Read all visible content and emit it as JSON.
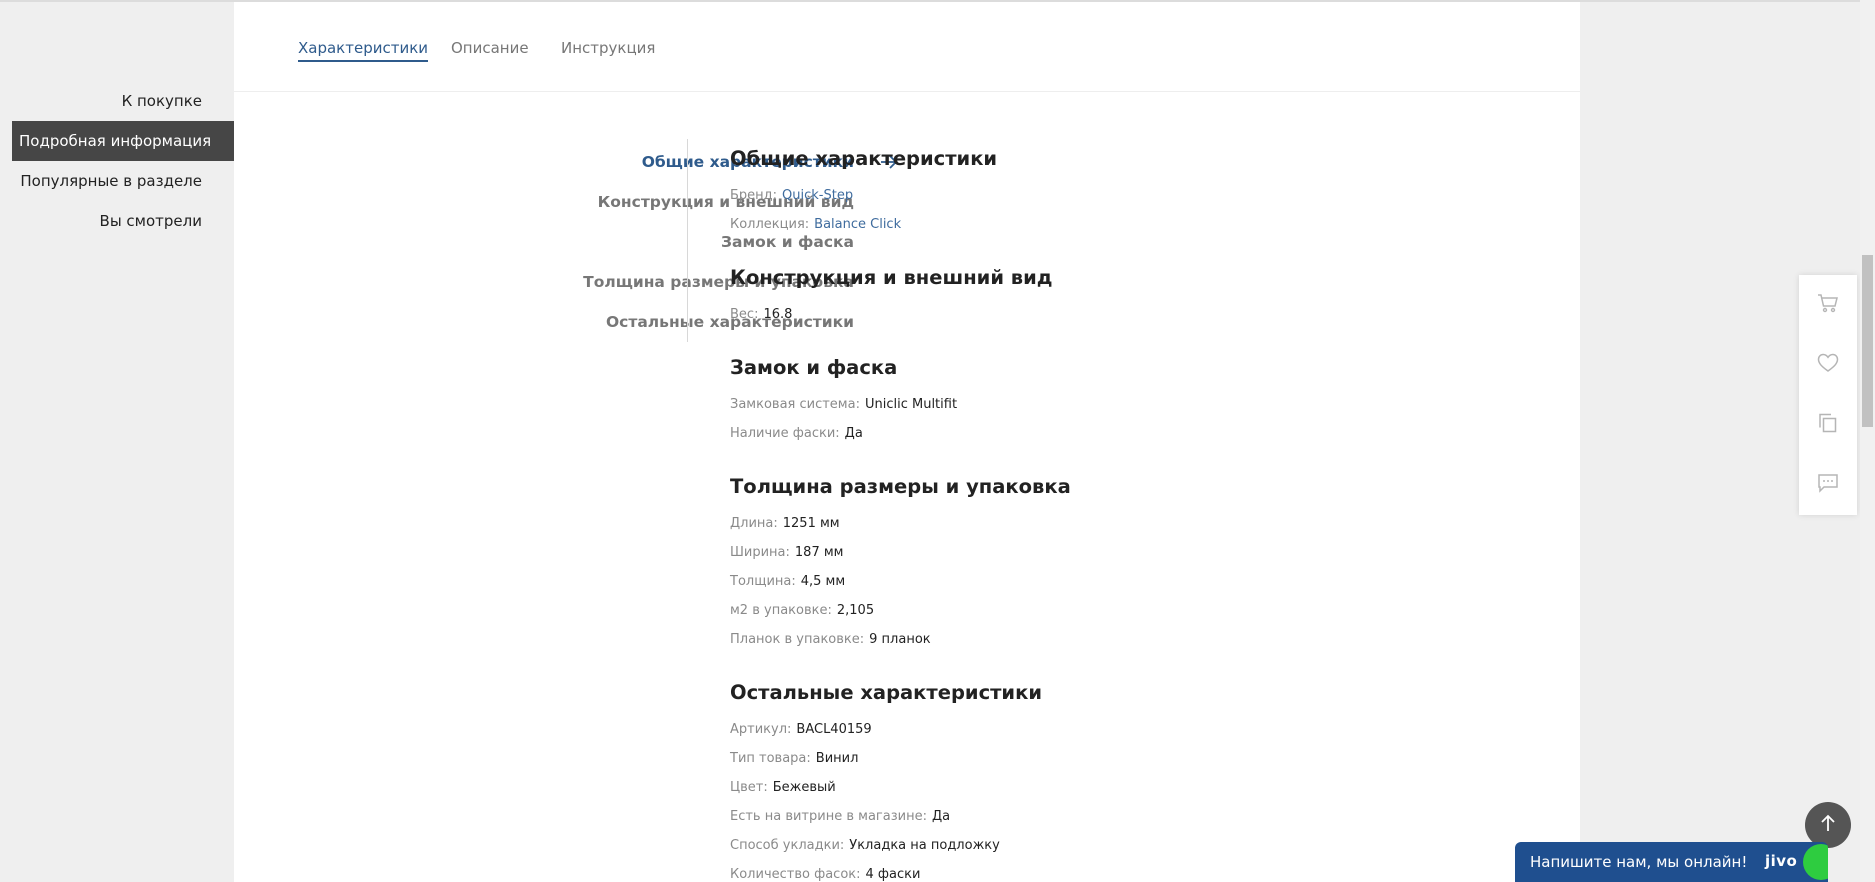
{
  "page_nav": {
    "items": [
      {
        "label": "К покупке",
        "active": false
      },
      {
        "label": "Подробная информация",
        "active": true
      },
      {
        "label": "Популярные в разделе",
        "active": false
      },
      {
        "label": "Вы смотрели",
        "active": false
      }
    ]
  },
  "tabs": [
    {
      "label": "Характеристики",
      "active": true
    },
    {
      "label": "Описание",
      "active": false
    },
    {
      "label": "Инструкция",
      "active": false
    }
  ],
  "section_nav": [
    {
      "label": "Общие характеристики",
      "active": true
    },
    {
      "label": "Конструкция и внешний вид",
      "active": false
    },
    {
      "label": "Замок и фаска",
      "active": false
    },
    {
      "label": "Толщина размеры и упаковка",
      "active": false
    },
    {
      "label": "Остальные характеристики",
      "active": false
    }
  ],
  "sections": [
    {
      "title": "Общие характеристики",
      "rows": [
        {
          "label": "Бренд:",
          "value": "Quick-Step",
          "link": true
        },
        {
          "label": "Коллекция:",
          "value": "Balance Click",
          "link": true
        }
      ]
    },
    {
      "title": "Конструкция и внешний вид",
      "rows": [
        {
          "label": "Вес:",
          "value": "16.8",
          "link": false
        }
      ]
    },
    {
      "title": "Замок и фаска",
      "rows": [
        {
          "label": "Замковая система:",
          "value": "Uniclic Multifit",
          "link": false
        },
        {
          "label": "Наличие фаски:",
          "value": "Да",
          "link": false
        }
      ]
    },
    {
      "title": "Толщина размеры и упаковка",
      "rows": [
        {
          "label": "Длина:",
          "value": "1251 мм",
          "link": false
        },
        {
          "label": "Ширина:",
          "value": "187 мм",
          "link": false
        },
        {
          "label": "Толщина:",
          "value": "4,5 мм",
          "link": false
        },
        {
          "label": "м2 в упаковке:",
          "value": "2,105",
          "link": false
        },
        {
          "label": "Планок в упаковке:",
          "value": "9 планок",
          "link": false
        }
      ]
    },
    {
      "title": "Остальные характеристики",
      "rows": [
        {
          "label": "Артикул:",
          "value": "BACL40159",
          "link": false
        },
        {
          "label": "Тип товара:",
          "value": "Винил",
          "link": false
        },
        {
          "label": "Цвет:",
          "value": "Бежевый",
          "link": false
        },
        {
          "label": "Есть на витрине в магазине:",
          "value": "Да",
          "link": false
        },
        {
          "label": "Способ укладки:",
          "value": "Укладка на подложку",
          "link": false
        },
        {
          "label": "Количество фасок:",
          "value": "4 фаски",
          "link": false
        }
      ]
    }
  ],
  "float_bar": {
    "icons": [
      "cart-icon",
      "heart-icon",
      "compare-icon",
      "chat-icon"
    ]
  },
  "chat_widget": {
    "text": "Напишите нам, мы онлайн!",
    "logo": "jivo"
  },
  "colors": {
    "accent": "#2f5b8c",
    "link": "#3f6c9e",
    "active_nav_bg": "#464646",
    "chat_bg": "#1f4f8f"
  }
}
